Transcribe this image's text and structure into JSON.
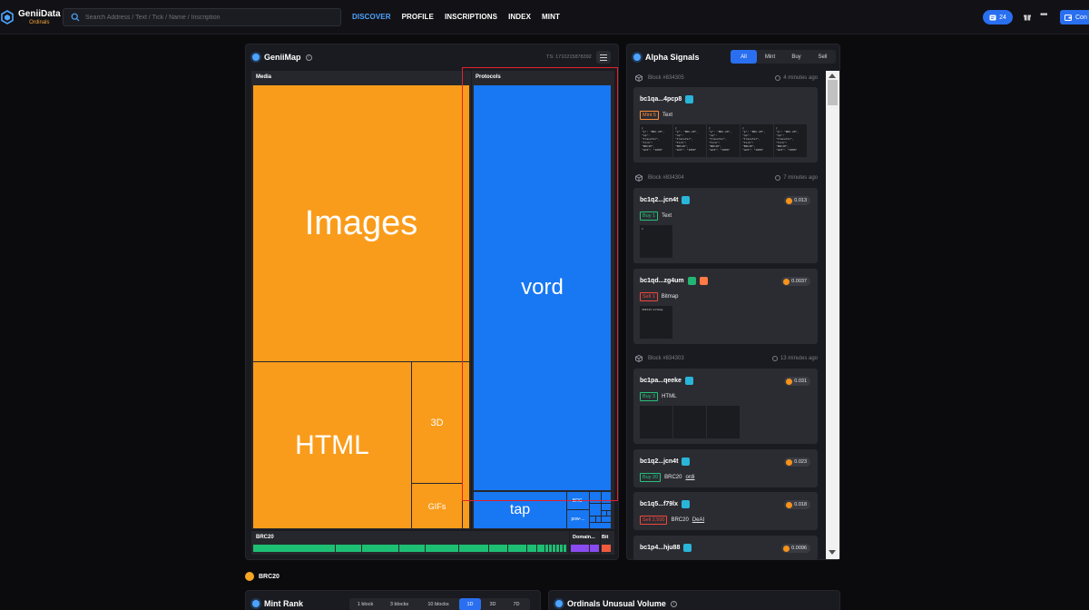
{
  "brand": {
    "title": "GeniiData",
    "subtitle": "Ordinals"
  },
  "search": {
    "placeholder": "Search Address / Text / Tick / Name / Inscription"
  },
  "nav": [
    "DISCOVER",
    "PROFILE",
    "INSCRIPTIONS",
    "INDEX",
    "MINT"
  ],
  "header": {
    "notifications": "24",
    "connect_label": "Con"
  },
  "map": {
    "title": "GeniiMap",
    "ts": "TS: 1710215878392",
    "sections": {
      "media": "Media",
      "protocols": "Protocols",
      "brc20": "BRC20",
      "domain": "Domain...",
      "bit": "Bit"
    },
    "tiles": {
      "images": "Images",
      "html": "HTML",
      "td": "3D",
      "gifs": "GIFs",
      "vord": "vord",
      "tap": "tap",
      "brc": "BRC-",
      "pow": "pow-..."
    }
  },
  "alpha": {
    "title": "Alpha Signals",
    "tabs": [
      "All",
      "Mint",
      "Buy",
      "Sell"
    ],
    "blocks": [
      {
        "label": "Block #834305",
        "time": "4 minutes ago"
      },
      {
        "label": "Block #834304",
        "time": "7 minutes ago"
      },
      {
        "label": "Block #834303",
        "time": "13 minutes ago"
      }
    ],
    "cards": [
      {
        "addr": "bc1qa...4pcp8",
        "tag": "Mint 5",
        "kind": "Text",
        "price": ""
      },
      {
        "addr": "bc1q2...jcn4t",
        "tag": "Buy 1",
        "kind": "Text",
        "price": "0.013"
      },
      {
        "addr": "bc1qd...zg4um",
        "tag": "Sell 1",
        "kind": "Bitmap",
        "price": "0.0037"
      },
      {
        "addr": "bc1pa...qeeke",
        "tag": "Buy 3",
        "kind": "HTML",
        "price": "0.031"
      },
      {
        "addr": "bc1q2...jcn4t",
        "tag": "Buy 20",
        "kind": "BRC20",
        "tick": "ordi",
        "price": "0.023"
      },
      {
        "addr": "bc1q5...f79lx",
        "tag": "Sell 2,500",
        "kind": "BRC20",
        "tick": "DeAI",
        "price": "0.018"
      },
      {
        "addr": "bc1p4...hju88",
        "tag": "",
        "kind": "",
        "price": "0.0096"
      }
    ],
    "thumb_text": {
      "json": "{\n\"p\": \"BRC-20\",\n\"op\":\n\"transfer\",\n\"tick\":\n\"BRC20\",\n\"amt\": \"1000\"",
      "digit": "1",
      "bitmap": "399143.bitmap"
    }
  },
  "bottom": {
    "brc20_label": "BRC20",
    "mint_rank": "Mint Rank",
    "range_tabs": [
      "1 block",
      "3 blocks",
      "10 blocks",
      "1D",
      "3D",
      "7D"
    ],
    "unusual": "Ordinals Unusual Volume"
  }
}
